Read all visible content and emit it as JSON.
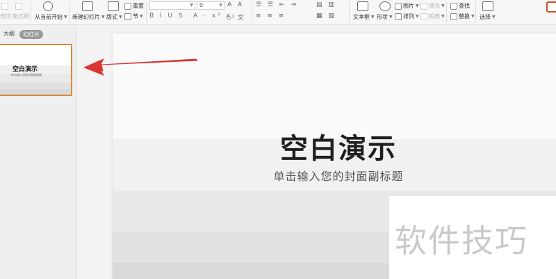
{
  "ribbon": {
    "cut": "剪切",
    "format_painter": "格式刷",
    "from_current": "从当前开始",
    "new_slide": "新建幻灯片",
    "layout": "版式",
    "reset": "重置",
    "section": "节",
    "font_size_value": "0",
    "textbox": "文本框",
    "shape": "形状",
    "picture": "图片",
    "fill": "填充",
    "arrange": "排列",
    "outline": "轮廓",
    "find": "查找",
    "replace": "替换",
    "select": "选择",
    "font_tools": "B I U S",
    "font_tools2": "A · x² x₂",
    "align_tools": "≡ ≡ ≡"
  },
  "panel": {
    "outline_tab": "大纲",
    "slides_tab": "幻灯片"
  },
  "thumbnail": {
    "title": "空白演示",
    "subtitle": "单击输入您的封面副标题"
  },
  "slide": {
    "title": "空白演示",
    "subtitle": "单击输入您的封面副标题"
  },
  "watermark": {
    "text": "软件技巧"
  },
  "colors": {
    "arrow": "#d93535",
    "selection": "#d98a3a"
  }
}
